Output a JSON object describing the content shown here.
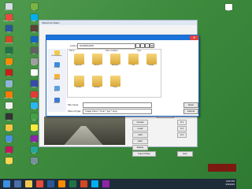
{
  "desktop": {
    "icons": [
      {
        "label": "Recycle Bin",
        "color": "#d8dde5",
        "icon": "recycle-bin-icon"
      },
      {
        "label": "Google Chrome",
        "color": "#e84b3c",
        "icon": "chrome-icon"
      },
      {
        "label": "Word",
        "color": "#2b579a",
        "icon": "word-icon"
      },
      {
        "label": "PowerPoint",
        "color": "#d24726",
        "icon": "powerpoint-icon"
      },
      {
        "label": "Excel",
        "color": "#217346",
        "icon": "excel-icon"
      },
      {
        "label": "Firefox",
        "color": "#ff8a00",
        "icon": "firefox-icon"
      },
      {
        "label": "PDF",
        "color": "#c4211b",
        "icon": "pdf-icon"
      },
      {
        "label": "Notepad",
        "color": "#8fb6d8",
        "icon": "notepad-icon"
      },
      {
        "label": "Media Player",
        "color": "#ff7a00",
        "icon": "media-player-icon"
      },
      {
        "label": "App",
        "color": "#f0f0f0",
        "icon": "app-icon"
      },
      {
        "label": "Video",
        "color": "#333333",
        "icon": "video-icon"
      },
      {
        "label": "Folder",
        "color": "#f5c542",
        "icon": "folder-icon"
      },
      {
        "label": "Photos",
        "color": "#4a90e2",
        "icon": "photos-icon"
      },
      {
        "label": "Music",
        "color": "#c2185b",
        "icon": "music-icon"
      },
      {
        "label": "Paint",
        "color": "#ffd54f",
        "icon": "paint-icon"
      },
      {
        "label": "Calc",
        "color": "#7cb342",
        "icon": "calculator-icon"
      },
      {
        "label": "Skype",
        "color": "#00aff0",
        "icon": "skype-icon"
      },
      {
        "label": "Game",
        "color": "#5d4037",
        "icon": "game-icon"
      },
      {
        "label": "Mail",
        "color": "#1565c0",
        "icon": "mail-icon"
      },
      {
        "label": "Tool",
        "color": "#616161",
        "icon": "tool-icon"
      },
      {
        "label": "Camera",
        "color": "#9e9e9e",
        "icon": "camera-icon"
      },
      {
        "label": "Docs",
        "color": "#ffffff",
        "icon": "docs-icon"
      },
      {
        "label": "Editor",
        "color": "#3949ab",
        "icon": "editor-icon"
      },
      {
        "label": "Player",
        "color": "#e53935",
        "icon": "player-icon"
      },
      {
        "label": "Cloud",
        "color": "#29b6f6",
        "icon": "cloud-icon"
      },
      {
        "label": "Shop",
        "color": "#43a047",
        "icon": "shop-icon"
      },
      {
        "label": "Help",
        "color": "#ffeb3b",
        "icon": "help-icon"
      },
      {
        "label": "Chat",
        "color": "#8e24aa",
        "icon": "chat-icon"
      },
      {
        "label": "Map",
        "color": "#26a69a",
        "icon": "map-icon"
      },
      {
        "label": "Disk",
        "color": "#78909c",
        "icon": "disk-icon"
      }
    ],
    "right_icon": {
      "label": "File",
      "color": "#ffffff"
    }
  },
  "parent_window": {
    "title": "Slideshow Maker",
    "side_buttons": [
      "Create",
      "Load",
      "Add",
      "Edit",
      "Delete",
      "Import Files",
      "Exit"
    ],
    "dropdown_value": "Slide",
    "small_fields": [
      "0.1",
      "0.1",
      "0.1"
    ]
  },
  "open_dialog": {
    "look_in_label": "Look in:",
    "look_in_value": "SLIDESHOW",
    "places": [
      {
        "label": "Recent places",
        "color": "#f2c94c"
      },
      {
        "label": "Desktop",
        "color": "#3c8ae0"
      },
      {
        "label": "Libraries",
        "color": "#f2b33d"
      },
      {
        "label": "This PC",
        "color": "#5aa0e0"
      },
      {
        "label": "Network",
        "color": "#3e7bd0"
      }
    ],
    "columns": [
      "Name",
      "Date modified",
      "Type"
    ],
    "folders": [
      {
        "label": "Autumn"
      },
      {
        "label": "Beach"
      },
      {
        "label": "Birthday"
      },
      {
        "label": "City"
      },
      {
        "label": "Family"
      },
      {
        "label": "Garden"
      },
      {
        "label": "Holiday"
      },
      {
        "label": "Party"
      }
    ],
    "file_name_label": "File name:",
    "file_name_value": "",
    "file_type_label": "Files of type:",
    "file_type_value": "Image Files (*.bmp;*.jpg;*.png)",
    "open_label": "Open",
    "cancel_label": "Cancel"
  },
  "taskbar": {
    "apps": [
      {
        "color": "#3d8fe0",
        "icon": "start-icon"
      },
      {
        "color": "#4b6fa8",
        "icon": "search-icon"
      },
      {
        "color": "#f2c94c",
        "icon": "file-explorer-icon"
      },
      {
        "color": "#e84b3c",
        "icon": "chrome-icon"
      },
      {
        "color": "#2b579a",
        "icon": "word-icon"
      },
      {
        "color": "#ff8a00",
        "icon": "firefox-icon"
      },
      {
        "color": "#217346",
        "icon": "excel-icon"
      },
      {
        "color": "#d24726",
        "icon": "powerpoint-icon"
      },
      {
        "color": "#00aff0",
        "icon": "store-icon"
      },
      {
        "color": "#8e24aa",
        "icon": "media-icon"
      }
    ],
    "time": "3:00 PM",
    "date": "4/5/2015"
  }
}
